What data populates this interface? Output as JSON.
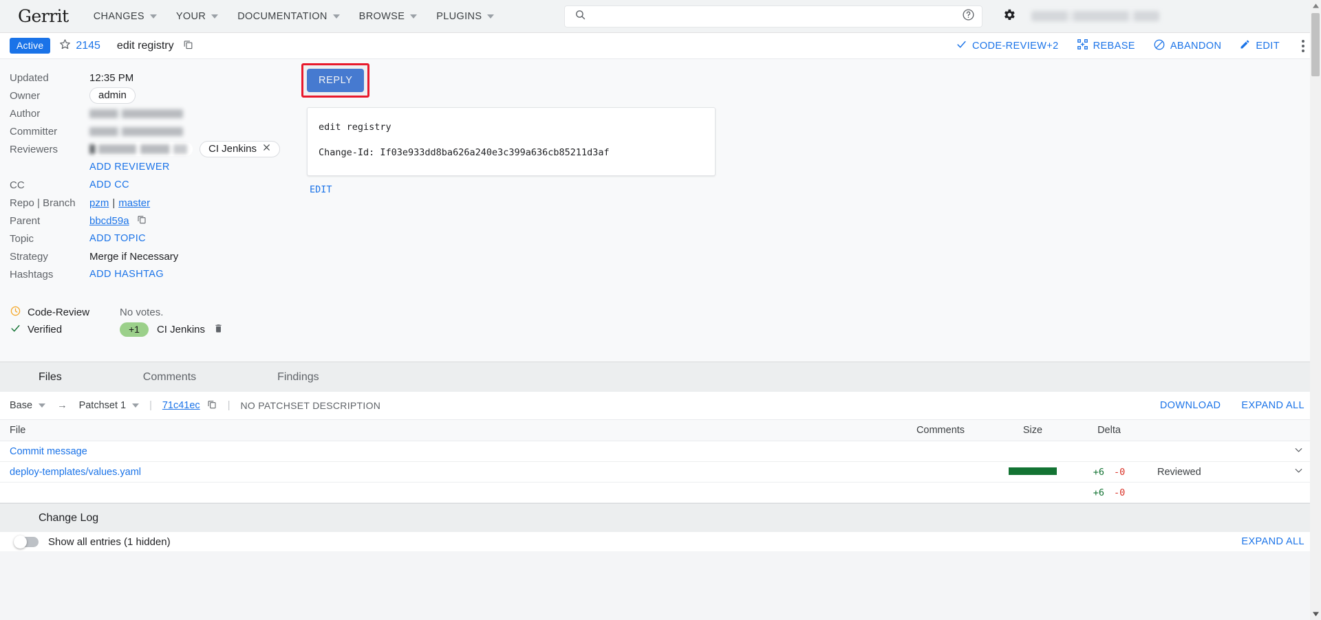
{
  "topnav": {
    "brand": "Gerrit",
    "items": [
      {
        "label": "CHANGES"
      },
      {
        "label": "YOUR"
      },
      {
        "label": "DOCUMENTATION"
      },
      {
        "label": "BROWSE"
      },
      {
        "label": "PLUGINS"
      }
    ],
    "search": {
      "value": "",
      "placeholder": ""
    },
    "help_icon": "help-circle-icon",
    "settings_icon": "gear-icon",
    "user_name": ""
  },
  "change_header": {
    "status": "Active",
    "star_icon": "star-outline-icon",
    "change_number": "2145",
    "subject": "edit registry",
    "copy_icon": "copy-icon",
    "actions": [
      {
        "label": "CODE-REVIEW+2",
        "icon": "check-icon"
      },
      {
        "label": "REBASE",
        "icon": "rebase-icon"
      },
      {
        "label": "ABANDON",
        "icon": "block-circle-icon"
      },
      {
        "label": "EDIT",
        "icon": "pencil-icon"
      }
    ],
    "overflow_icon": "kebab-menu-icon"
  },
  "metadata": {
    "updated_label": "Updated",
    "updated_value": "12:35 PM",
    "owner_label": "Owner",
    "owner_value": "admin",
    "author_label": "Author",
    "committer_label": "Committer",
    "reviewers_label": "Reviewers",
    "reviewer_chip": "CI Jenkins",
    "add_reviewer": "ADD REVIEWER",
    "cc_label": "CC",
    "add_cc": "ADD CC",
    "repo_branch_label": "Repo | Branch",
    "repo": "pzm",
    "branch": "master",
    "parent_label": "Parent",
    "parent_value": "bbcd59a",
    "topic_label": "Topic",
    "add_topic": "ADD TOPIC",
    "strategy_label": "Strategy",
    "strategy_value": "Merge if Necessary",
    "hashtags_label": "Hashtags",
    "add_hashtag": "ADD HASHTAG"
  },
  "labels": {
    "code_review": {
      "name": "Code-Review",
      "icon": "clock-icon",
      "value": "No votes."
    },
    "verified": {
      "name": "Verified",
      "icon": "check-icon",
      "vote": "+1",
      "voter": "CI Jenkins",
      "delete_icon": "trash-icon"
    }
  },
  "reply": {
    "button_label": "REPLY",
    "highlighted": true
  },
  "commit_message": {
    "line1": "edit registry",
    "line2": "Change-Id: If03e933dd8ba626a240e3c399a636cb85211d3af",
    "edit_label": "EDIT"
  },
  "tabs": [
    {
      "label": "Files",
      "active": true
    },
    {
      "label": "Comments",
      "active": false
    },
    {
      "label": "Findings",
      "active": false
    }
  ],
  "patchset_bar": {
    "base": "Base",
    "arrow": "→",
    "patchset": "Patchset 1",
    "revision": "71c41ec",
    "copy_icon": "copy-icon",
    "description": "NO PATCHSET DESCRIPTION",
    "download": "DOWNLOAD",
    "expand_all": "EXPAND ALL"
  },
  "file_table": {
    "columns": {
      "file": "File",
      "comments": "Comments",
      "size": "Size",
      "delta": "Delta"
    },
    "rows": [
      {
        "file": "Commit message",
        "comments": "",
        "has_size_bar": false,
        "added": "",
        "removed": "",
        "status": "",
        "expand_icon": "chevron-down-icon"
      },
      {
        "file": "deploy-templates/values.yaml",
        "comments": "",
        "has_size_bar": true,
        "added": "+6",
        "removed": "-0",
        "status": "Reviewed",
        "expand_icon": "chevron-down-icon"
      }
    ],
    "totals": {
      "added": "+6",
      "removed": "-0"
    }
  },
  "change_log": {
    "title": "Change Log",
    "toggle_label": "Show all entries (1 hidden)",
    "expand_all": "EXPAND ALL"
  },
  "scrollbar": {
    "up_icon": "scroll-up-arrow-icon",
    "down_icon": "scroll-down-arrow-icon"
  },
  "colors": {
    "accent_blue": "#1a73e8",
    "reply_blue": "#1f62d0",
    "status_blue": "#1a73e8",
    "vote_green": "#9bd08a",
    "size_bar_green": "#137333",
    "added_green": "#137333",
    "removed_red": "#d93025",
    "highlight_red": "#e8192c",
    "clock_orange": "#f5a623",
    "check_green": "#137333"
  }
}
